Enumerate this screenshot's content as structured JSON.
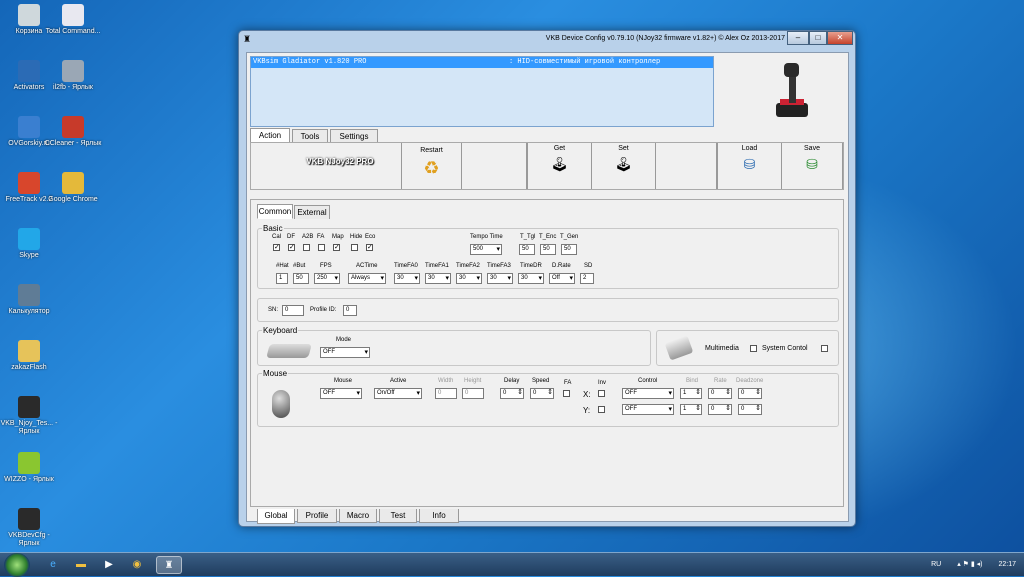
{
  "desktop": {
    "icons": [
      {
        "label": "Корзина",
        "color": "#cfd8dc"
      },
      {
        "label": "Total Command...",
        "color": "#e8e8f0"
      },
      {
        "label": "Activators",
        "color": "#2b6bb5"
      },
      {
        "label": "il2fb - Ярлык",
        "color": "#9aa7b5"
      },
      {
        "label": "OVGorskiy.ru",
        "color": "#3a7fd0"
      },
      {
        "label": "CCleaner - Ярлык",
        "color": "#c73a2a"
      },
      {
        "label": "FreeTrack v2.2",
        "color": "#d8462c"
      },
      {
        "label": "Google Chrome",
        "color": "#e4b93a"
      },
      {
        "label": "Skype",
        "color": "#22a7e8"
      },
      {
        "label": "Калькулятор",
        "color": "#5f7c96"
      },
      {
        "label": "zakazFlash",
        "color": "#e6c35a"
      },
      {
        "label": "VKB_Njoy_Tes... - Ярлык",
        "color": "#2a2a2a"
      },
      {
        "label": "WIZZO - Ярлык",
        "color": "#8ac630"
      },
      {
        "label": "VKBDevCfg - Ярлык",
        "color": "#2a2a2a"
      }
    ]
  },
  "window": {
    "title": "VKB Device Config v0.79.10 (NJoy32 firmware v1.82+) © Alex Oz 2013-2017",
    "min": "–",
    "max": "□",
    "close": "✕"
  },
  "banner": {
    "device": "VKBsim Gladiator  v1.820 PRO",
    "desc": ": HID-совместимый игровой контроллер"
  },
  "tabs": [
    "Action",
    "Tools",
    "Settings"
  ],
  "toolbar": {
    "device_name": "VKB NJoy32 PRO",
    "restart": "Restart",
    "get": "Get",
    "set": "Set",
    "load": "Load",
    "save": "Save"
  },
  "subtabs": [
    "Common",
    "External"
  ],
  "basic": {
    "title": "Basic",
    "checks": [
      {
        "label": "Cal",
        "checked": true
      },
      {
        "label": "DF",
        "checked": true
      },
      {
        "label": "A2B",
        "checked": false
      },
      {
        "label": "FA",
        "checked": false
      },
      {
        "label": "Map",
        "checked": true
      },
      {
        "label": "Hide",
        "checked": false
      },
      {
        "label": "Eco",
        "checked": true
      }
    ],
    "tempo_label": "Tempo Time",
    "tempo_value": "500",
    "t_tgl_label": "T_Tgl",
    "t_tgl": "50",
    "t_enc_label": "T_Enc",
    "t_enc": "50",
    "t_gen_label": "T_Gen",
    "t_gen": "50",
    "hat_label": "#Hat",
    "hat": "1",
    "but_label": "#But",
    "but": "50",
    "fps_label": "FPS",
    "fps": "250",
    "actime_label": "ACTime",
    "actime": "Always",
    "timefa0_label": "TimeFA0",
    "timefa0": "30",
    "timefa1_label": "TimeFA1",
    "timefa1": "30",
    "timefa2_label": "TimeFA2",
    "timefa2": "30",
    "timefa3_label": "TimeFA3",
    "timefa3": "30",
    "timedr_label": "TimeDR",
    "timedr": "30",
    "drate_label": "D.Rate",
    "drate": "Off",
    "sd_label": "SD",
    "sd": "2"
  },
  "serial": {
    "sn_label": "SN:",
    "sn": "0",
    "pid_label": "Profile ID:",
    "pid": "0"
  },
  "keyboard": {
    "title": "Keyboard",
    "mode_label": "Mode",
    "mode": "OFF",
    "multimedia": "Multimedia",
    "system": "System Contol"
  },
  "mouse": {
    "title": "Mouse",
    "mouse_label": "Mouse",
    "mouse": "OFF",
    "active_label": "Active",
    "active": "On/Off",
    "width_label": "Width",
    "width": "0",
    "height_label": "Height",
    "height": "0",
    "delay_label": "Delay",
    "delay": "0",
    "speed_label": "Speed",
    "speed": "0",
    "fa_label": "FA",
    "inv_label": "Inv",
    "x_label": "X:",
    "y_label": "Y:",
    "control_label": "Control",
    "control_x": "OFF",
    "control_y": "OFF",
    "bind_label": "Bind",
    "bind_x": "1",
    "bind_y": "1",
    "rate_label": "Rate",
    "rate_x": "0",
    "rate_y": "0",
    "dz_label": "Deadzone",
    "dz_x": "0",
    "dz_y": "0"
  },
  "bottom_tabs": [
    "Global",
    "Profile",
    "Macro",
    "Test",
    "Info"
  ],
  "tray": {
    "lang": "RU",
    "time": "22:17"
  }
}
